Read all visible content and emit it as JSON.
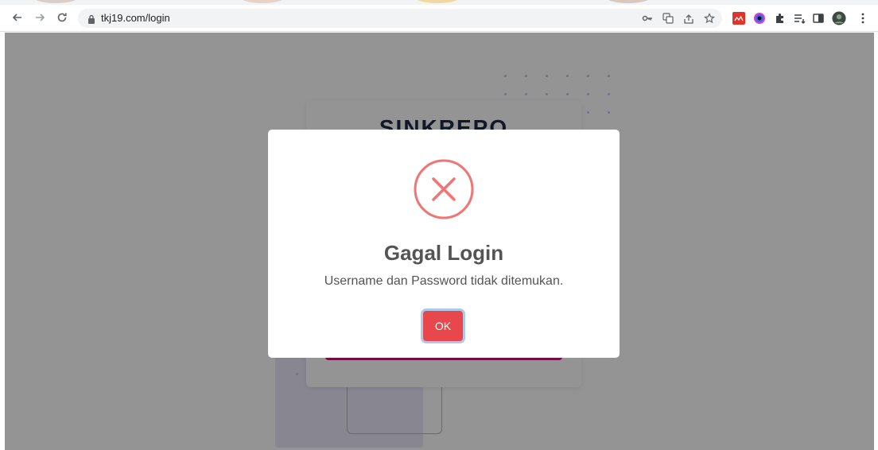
{
  "browser": {
    "url": "tkj19.com/login",
    "toolbar_icons": [
      "back-icon",
      "forward-icon",
      "reload-icon",
      "lock-icon",
      "key-icon",
      "translate-icon",
      "share-icon",
      "bookmark-star-icon",
      "extension-red-icon",
      "extension-color-icon",
      "puzzle-icon",
      "reading-list-icon",
      "side-panel-icon",
      "profile-avatar-icon",
      "menu-kebab-icon"
    ]
  },
  "login_page": {
    "title": "SINKREPO"
  },
  "dialog": {
    "icon": "error-x-icon",
    "title": "Gagal Login",
    "message": "Username dan Password tidak ditemukan.",
    "confirm_label": "OK"
  },
  "colors": {
    "error": "#f27474",
    "confirm_button": "#e8474b",
    "text": "#545454",
    "overlay": "rgba(0,0,0,0.42)",
    "accent_pink": "#c3177f"
  }
}
